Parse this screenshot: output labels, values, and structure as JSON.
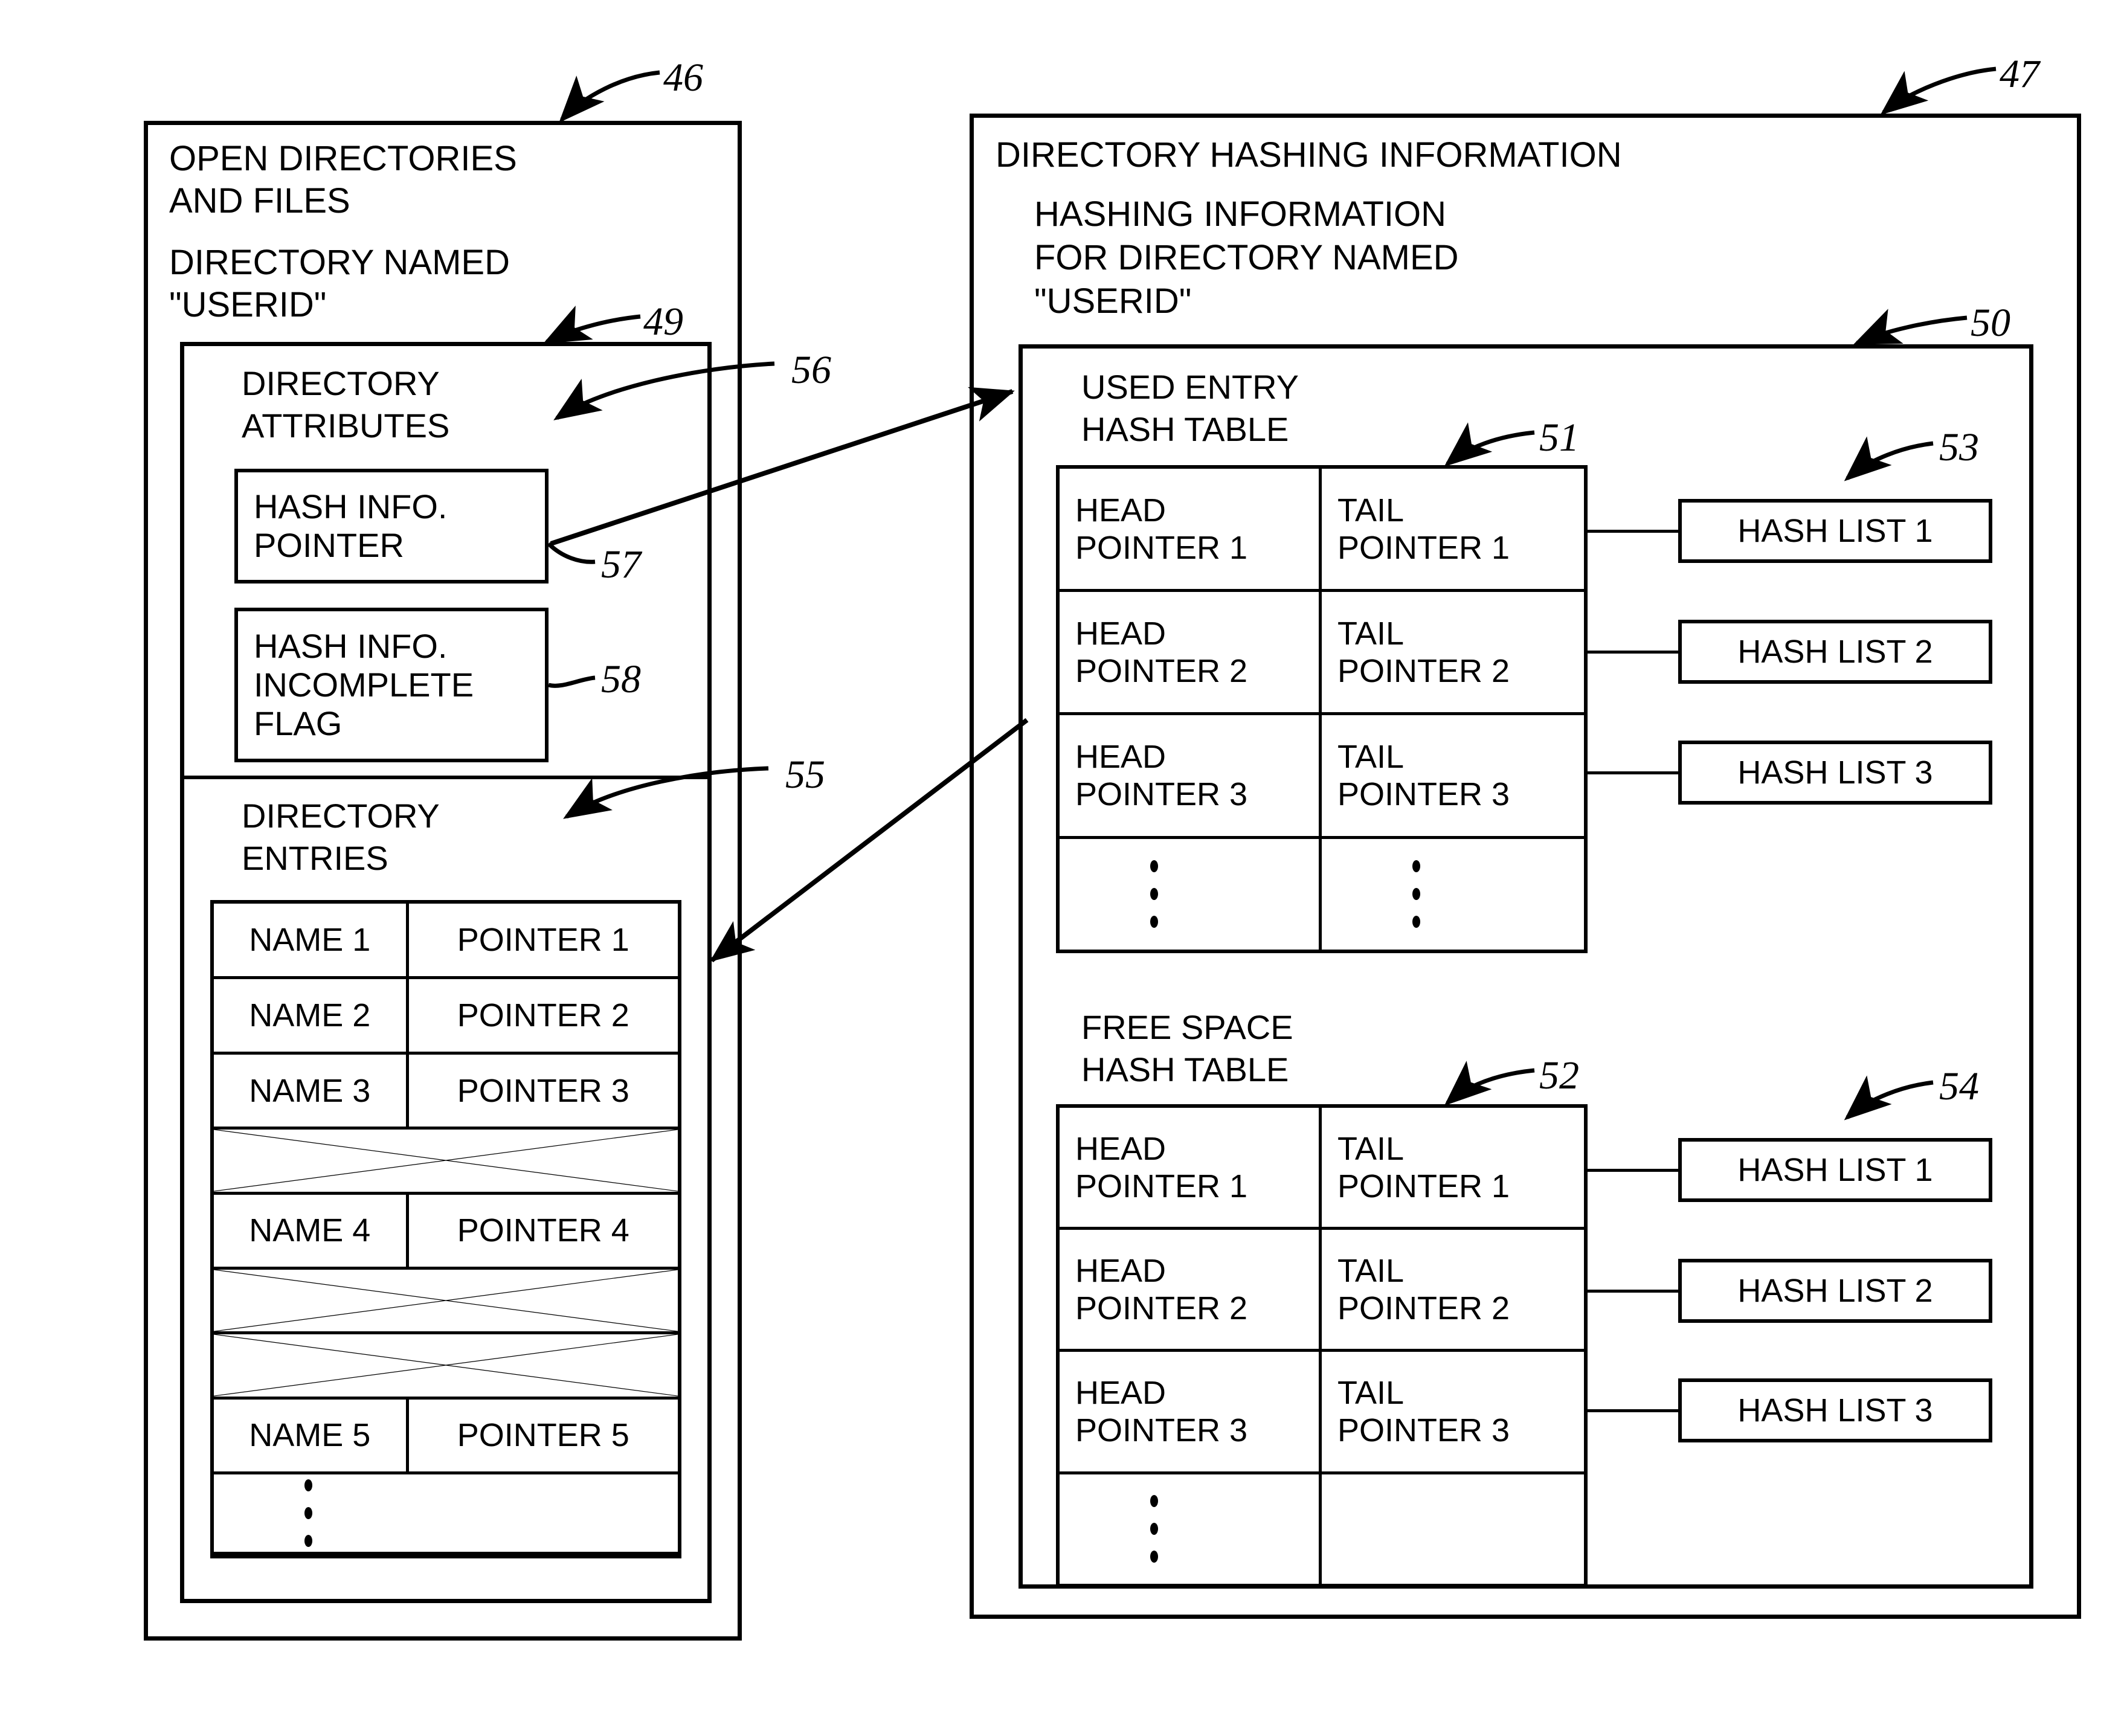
{
  "figure": {
    "left_panel": {
      "ref": "46",
      "title_line1": "OPEN DIRECTORIES",
      "title_line2": "AND FILES",
      "subtitle_line1": "DIRECTORY NAMED",
      "subtitle_line2": "\"USERID\"",
      "inner_ref": "49",
      "attributes_section": {
        "ref": "56",
        "heading_line1": "DIRECTORY",
        "heading_line2": "ATTRIBUTES",
        "boxes": [
          {
            "ref": "57",
            "label": "HASH INFO.\nPOINTER"
          },
          {
            "ref": "58",
            "label": "HASH INFO.\nINCOMPLETE\nFLAG"
          }
        ]
      },
      "entries_section": {
        "ref": "55",
        "heading_line1": "DIRECTORY",
        "heading_line2": "ENTRIES",
        "rows": [
          {
            "type": "entry",
            "name": "NAME 1",
            "pointer": "POINTER 1"
          },
          {
            "type": "entry",
            "name": "NAME 2",
            "pointer": "POINTER 2"
          },
          {
            "type": "entry",
            "name": "NAME 3",
            "pointer": "POINTER 3"
          },
          {
            "type": "crossed",
            "name": "",
            "pointer": ""
          },
          {
            "type": "entry",
            "name": "NAME 4",
            "pointer": "POINTER 4"
          },
          {
            "type": "crossed",
            "name": "",
            "pointer": ""
          },
          {
            "type": "crossed",
            "name": "",
            "pointer": ""
          },
          {
            "type": "entry",
            "name": "NAME 5",
            "pointer": "POINTER 5"
          },
          {
            "type": "dots",
            "name": "",
            "pointer": ""
          }
        ]
      }
    },
    "right_panel": {
      "ref": "47",
      "title": "DIRECTORY HASHING INFORMATION",
      "subtitle_line1": "HASHING INFORMATION",
      "subtitle_line2": "FOR DIRECTORY NAMED",
      "subtitle_line3": "\"USERID\"",
      "inner_ref": "50",
      "used_entry_table": {
        "ref": "51",
        "heading_line1": "USED ENTRY",
        "heading_line2": "HASH TABLE",
        "rows": [
          {
            "head": "HEAD\nPOINTER 1",
            "tail": "TAIL\nPOINTER 1"
          },
          {
            "head": "HEAD\nPOINTER 2",
            "tail": "TAIL\nPOINTER 2"
          },
          {
            "head": "HEAD\nPOINTER 3",
            "tail": "TAIL\nPOINTER 3"
          }
        ],
        "dots_row": {
          "head_dots": true,
          "tail_dots": true
        }
      },
      "used_hash_lists": {
        "ref": "53",
        "items": [
          "HASH LIST 1",
          "HASH LIST 2",
          "HASH LIST 3"
        ]
      },
      "free_space_table": {
        "ref": "52",
        "heading_line1": "FREE SPACE",
        "heading_line2": "HASH TABLE",
        "rows": [
          {
            "head": "HEAD\nPOINTER 1",
            "tail": "TAIL\nPOINTER 1"
          },
          {
            "head": "HEAD\nPOINTER 2",
            "tail": "TAIL\nPOINTER 2"
          },
          {
            "head": "HEAD\nPOINTER 3",
            "tail": "TAIL\nPOINTER 3"
          }
        ],
        "dots_row": {
          "head_dots": true,
          "tail_dots": false
        }
      },
      "free_hash_lists": {
        "ref": "54",
        "items": [
          "HASH LIST 1",
          "HASH LIST 2",
          "HASH LIST 3"
        ]
      }
    }
  }
}
